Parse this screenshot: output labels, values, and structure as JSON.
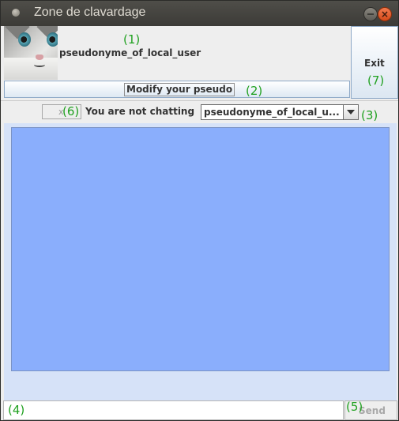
{
  "window": {
    "title": "Zone de clavardage"
  },
  "header": {
    "avatar": "kitten-avatar",
    "pseudo": "pseudonyme_of_local_user",
    "modify_label": "Modify your pseudo",
    "exit_label": "Exit"
  },
  "status": {
    "small_box_glyph": "x",
    "text": "You are not chatting",
    "selected_user": "pseudonyme_of_local_u..."
  },
  "chat": {
    "messages": []
  },
  "composer": {
    "message": "",
    "send_label": "Send"
  },
  "annotations": {
    "a1": "(1)",
    "a2": "(2)",
    "a3": "(3)",
    "a4": "(4)",
    "a5": "(5)",
    "a6": "(6)",
    "a7": "(7)"
  },
  "colors": {
    "chat_bg": "#8aaefc",
    "annotation": "#21a121",
    "close_button": "#e05a28"
  }
}
